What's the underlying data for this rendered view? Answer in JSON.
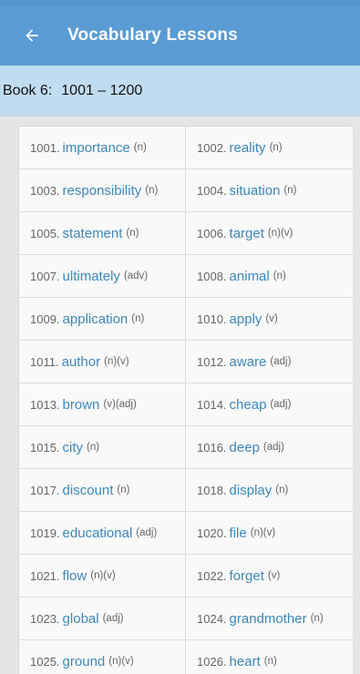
{
  "toolbar": {
    "title": "Vocabulary Lessons",
    "back_icon": "arrow-left-icon"
  },
  "subheader": {
    "book": "Book 6:",
    "range": "1001 – 1200"
  },
  "colors": {
    "toolbar": "#5a9bd4",
    "subheader": "#c0dcf0",
    "word": "#3d88b8"
  },
  "words": [
    {
      "num": "1001.",
      "word": "importance",
      "pos": "(n)"
    },
    {
      "num": "1002.",
      "word": "reality",
      "pos": "(n)"
    },
    {
      "num": "1003.",
      "word": "responsibility",
      "pos": "(n)"
    },
    {
      "num": "1004.",
      "word": "situation",
      "pos": "(n)"
    },
    {
      "num": "1005.",
      "word": "statement",
      "pos": "(n)"
    },
    {
      "num": "1006.",
      "word": "target",
      "pos": "(n)(v)"
    },
    {
      "num": "1007.",
      "word": "ultimately",
      "pos": "(adv)"
    },
    {
      "num": "1008.",
      "word": "animal",
      "pos": "(n)"
    },
    {
      "num": "1009.",
      "word": "application",
      "pos": "(n)"
    },
    {
      "num": "1010.",
      "word": "apply",
      "pos": "(v)"
    },
    {
      "num": "1011.",
      "word": "author",
      "pos": "(n)(v)"
    },
    {
      "num": "1012.",
      "word": "aware",
      "pos": "(adj)"
    },
    {
      "num": "1013.",
      "word": "brown",
      "pos": "(v)(adj)"
    },
    {
      "num": "1014.",
      "word": "cheap",
      "pos": "(adj)"
    },
    {
      "num": "1015.",
      "word": "city",
      "pos": "(n)"
    },
    {
      "num": "1016.",
      "word": "deep",
      "pos": "(adj)"
    },
    {
      "num": "1017.",
      "word": "discount",
      "pos": "(n)"
    },
    {
      "num": "1018.",
      "word": "display",
      "pos": "(n)"
    },
    {
      "num": "1019.",
      "word": "educational",
      "pos": "(adj)"
    },
    {
      "num": "1020.",
      "word": "file",
      "pos": "(n)(v)"
    },
    {
      "num": "1021.",
      "word": "flow",
      "pos": "(n)(v)"
    },
    {
      "num": "1022.",
      "word": "forget",
      "pos": "(v)"
    },
    {
      "num": "1023.",
      "word": "global",
      "pos": "(adj)"
    },
    {
      "num": "1024.",
      "word": "grandmother",
      "pos": "(n)"
    },
    {
      "num": "1025.",
      "word": "ground",
      "pos": "(n)(v)"
    },
    {
      "num": "1026.",
      "word": "heart",
      "pos": "(n)"
    }
  ]
}
